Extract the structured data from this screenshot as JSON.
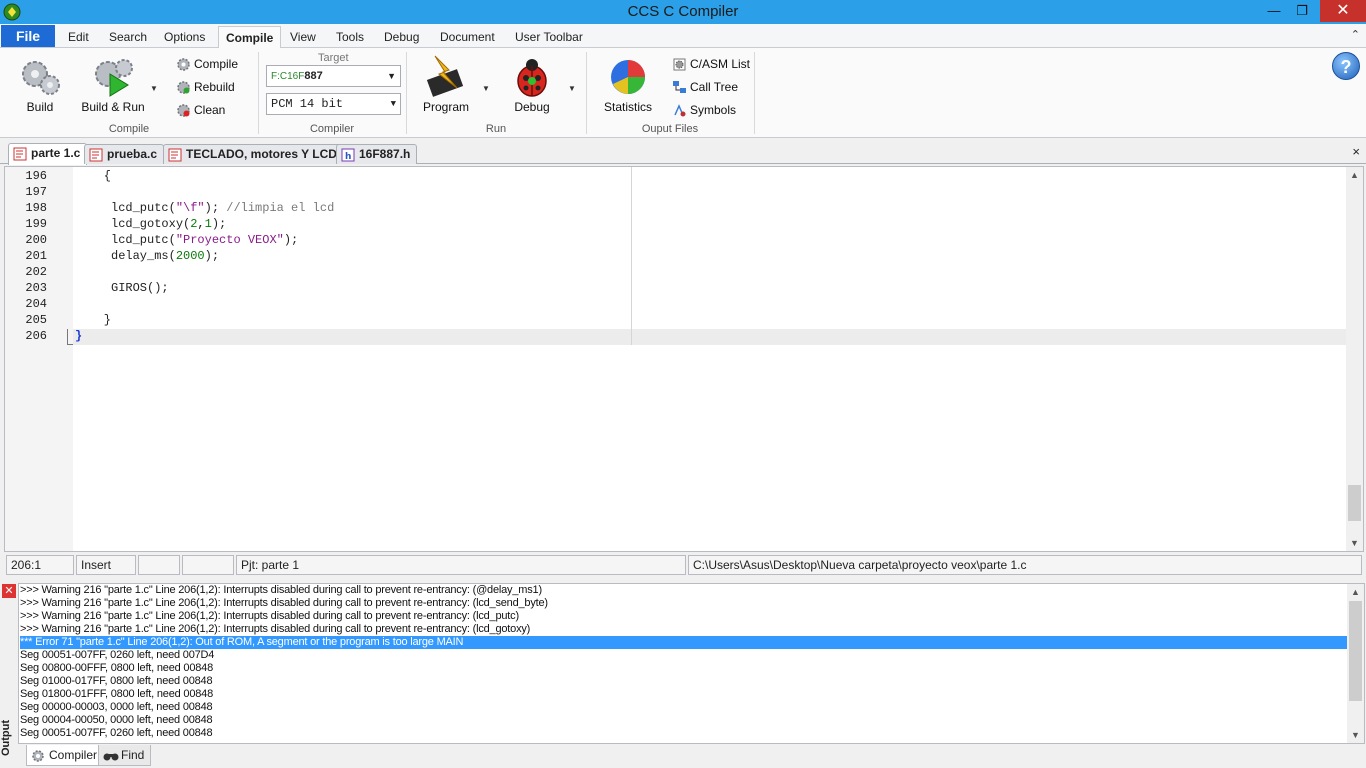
{
  "window": {
    "title": "CCS C Compiler",
    "minimize": "—",
    "maximize": "❐",
    "close": "✕"
  },
  "menu": {
    "file": "File",
    "tabs": [
      "Edit",
      "Search",
      "Options",
      "Compile",
      "View",
      "Tools",
      "Debug",
      "Document",
      "User Toolbar"
    ],
    "active_tab": "Compile",
    "collapse": "⌃"
  },
  "ribbon": {
    "compile_group": {
      "label": "Compile",
      "build": "Build",
      "build_run": "Build & Run",
      "compile": "Compile",
      "rebuild": "Rebuild",
      "clean": "Clean"
    },
    "compiler_group": {
      "label": "Compiler",
      "target_caption": "Target",
      "target_prefix": "F:C16F",
      "target_value": "887",
      "mode": "PCM 14 bit"
    },
    "run_group": {
      "label": "Run",
      "program": "Program",
      "debug": "Debug"
    },
    "output_group": {
      "label": "Ouput Files",
      "statistics": "Statistics",
      "casm_list": "C/ASM List",
      "call_tree": "Call Tree",
      "symbols": "Symbols"
    },
    "help": "?"
  },
  "doc_tabs": [
    "parte 1.c",
    "prueba.c",
    "TECLADO, motores Y LCD.c",
    "16F887.h"
  ],
  "doc_tabs_close": "×",
  "editor": {
    "line_numbers": [
      "196",
      "197",
      "198",
      "199",
      "200",
      "201",
      "202",
      "203",
      "204",
      "205",
      "206"
    ],
    "lines": {
      "l196": "    {",
      "l198_a": "     lcd_putc(",
      "l198_str": "\"\\f\"",
      "l198_b": "); ",
      "l198_com": "//limpia el lcd",
      "l199_a": "     lcd_gotoxy(",
      "l199_n1": "2",
      "l199_c": ",",
      "l199_n2": "1",
      "l199_b": ");",
      "l200_a": "     lcd_putc(",
      "l200_str": "\"Proyecto VEOX\"",
      "l200_b": ");",
      "l201_a": "     delay_ms(",
      "l201_num": "2000",
      "l201_b": ");",
      "l203": "     GIROS();",
      "l205": "    }",
      "l206": "}"
    }
  },
  "status": {
    "position": "206:1",
    "mode": "Insert",
    "cell3": "",
    "cell4": "",
    "project": "Pjt: parte 1",
    "spacer": "",
    "path": "C:\\Users\\Asus\\Desktop\\Nueva carpeta\\proyecto veox\\parte 1.c"
  },
  "output": {
    "label": "Output",
    "close": "✕",
    "lines": [
      ">>> Warning 216 \"parte 1.c\" Line 206(1,2): Interrupts disabled during call to prevent re-entrancy:  (@delay_ms1)",
      ">>> Warning 216 \"parte 1.c\" Line 206(1,2): Interrupts disabled during call to prevent re-entrancy:  (lcd_send_byte)",
      ">>> Warning 216 \"parte 1.c\" Line 206(1,2): Interrupts disabled during call to prevent re-entrancy:  (lcd_putc)",
      ">>> Warning 216 \"parte 1.c\" Line 206(1,2): Interrupts disabled during call to prevent re-entrancy:  (lcd_gotoxy)",
      "*** Error 71 \"parte 1.c\" Line 206(1,2): Out of ROM, A segment or the program is too large    MAIN",
      "   Seg 00051-007FF, 0260 left, need 007D4",
      "   Seg 00800-00FFF, 0800 left, need 00848",
      "   Seg 01000-017FF, 0800 left, need 00848",
      "   Seg 01800-01FFF, 0800 left, need 00848",
      "   Seg 00000-00003, 0000 left, need 00848",
      "   Seg 00004-00050, 0000 left, need 00848",
      "   Seg 00051-007FF, 0260 left, need 00848"
    ],
    "tabs": [
      "Compiler",
      "Find"
    ]
  },
  "colors": {
    "titlebar": "#2ba0e8",
    "file_menu": "#1e6bd6",
    "selection": "#3399ff",
    "close": "#c7312c"
  }
}
